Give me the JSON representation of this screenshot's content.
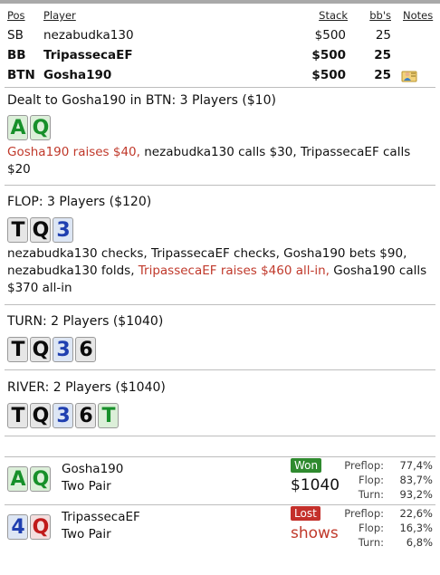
{
  "headers": {
    "pos": "Pos",
    "player": "Player",
    "stack": "Stack",
    "bbs": "bb's",
    "notes": "Notes"
  },
  "players": [
    {
      "pos": "SB",
      "name": "nezabudka130",
      "stack": "$500",
      "bbs": "25",
      "bold": false,
      "note": false
    },
    {
      "pos": "BB",
      "name": "TripassecaEF",
      "stack": "$500",
      "bbs": "25",
      "bold": true,
      "note": false
    },
    {
      "pos": "BTN",
      "name": "Gosha190",
      "stack": "$500",
      "bbs": "25",
      "bold": true,
      "note": true
    }
  ],
  "preflop": {
    "title": "Dealt to Gosha190 in BTN: 3 Players ($10)",
    "cards": [
      {
        "rank": "A",
        "suit": "club"
      },
      {
        "rank": "Q",
        "suit": "club"
      }
    ],
    "actions": [
      {
        "text": "Gosha190 raises $40,",
        "red": true
      },
      {
        "text": " nezabudka130 calls $30, TripassecaEF calls $20",
        "red": false
      }
    ]
  },
  "flop": {
    "title": "FLOP: 3 Players ($120)",
    "cards": [
      {
        "rank": "T",
        "suit": "spade"
      },
      {
        "rank": "Q",
        "suit": "spade"
      },
      {
        "rank": "3",
        "suit": "diamond"
      }
    ],
    "actions": [
      {
        "text": "nezabudka130 checks, TripassecaEF checks, Gosha190 bets $90, nezabudka130 folds, ",
        "red": false
      },
      {
        "text": "TripassecaEF raises $460 all-in,",
        "red": true
      },
      {
        "text": " Gosha190 calls $370 all-in",
        "red": false
      }
    ]
  },
  "turn": {
    "title": "TURN: 2 Players ($1040)",
    "cards": [
      {
        "rank": "T",
        "suit": "spade"
      },
      {
        "rank": "Q",
        "suit": "spade"
      },
      {
        "rank": "3",
        "suit": "diamond"
      },
      {
        "rank": "6",
        "suit": "spade"
      }
    ]
  },
  "river": {
    "title": "RIVER: 2 Players ($1040)",
    "cards": [
      {
        "rank": "T",
        "suit": "spade"
      },
      {
        "rank": "Q",
        "suit": "spade"
      },
      {
        "rank": "3",
        "suit": "diamond"
      },
      {
        "rank": "6",
        "suit": "spade"
      },
      {
        "rank": "T",
        "suit": "club"
      }
    ]
  },
  "results": [
    {
      "name": "Gosha190",
      "hand": "Two Pair",
      "cards": [
        {
          "rank": "A",
          "suit": "club"
        },
        {
          "rank": "Q",
          "suit": "club"
        }
      ],
      "badge": "Won",
      "badge_type": "won",
      "amount": "$1040",
      "equity": [
        {
          "label": "Preflop:",
          "value": "77,4%"
        },
        {
          "label": "Flop:",
          "value": "83,7%"
        },
        {
          "label": "Turn:",
          "value": "93,2%"
        }
      ]
    },
    {
      "name": "TripassecaEF",
      "hand": "Two Pair",
      "cards": [
        {
          "rank": "4",
          "suit": "diamond"
        },
        {
          "rank": "Q",
          "suit": "heart"
        }
      ],
      "badge": "Lost",
      "badge_type": "lost",
      "amount": "shows",
      "equity": [
        {
          "label": "Preflop:",
          "value": "22,6%"
        },
        {
          "label": "Flop:",
          "value": "16,3%"
        },
        {
          "label": "Turn:",
          "value": "6,8%"
        }
      ]
    }
  ]
}
